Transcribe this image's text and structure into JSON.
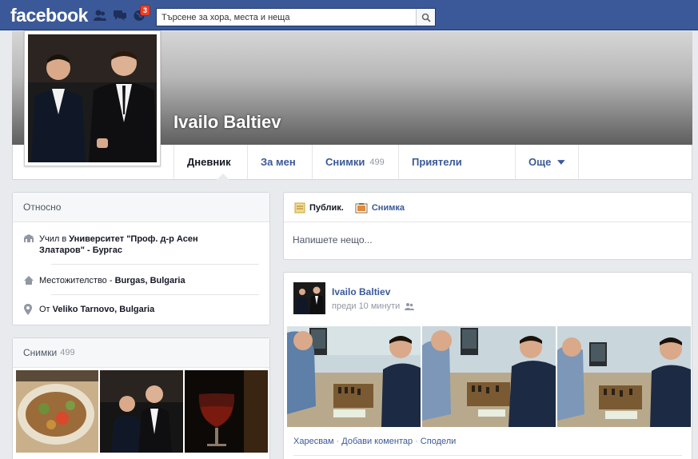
{
  "topbar": {
    "logo": "facebook",
    "notifications_count": "3",
    "search_placeholder": "Търсене за хора, места и неща"
  },
  "profile": {
    "name": "Ivailo Baltiev"
  },
  "nav": {
    "tabs": [
      {
        "label": "Дневник"
      },
      {
        "label": "За мен"
      },
      {
        "label": "Снимки",
        "count": "499"
      },
      {
        "label": "Приятели"
      },
      {
        "label": "Още"
      }
    ]
  },
  "about": {
    "title": "Относно",
    "studied_prefix": "Учил в",
    "studied_place": "Университет \"Проф. д-р Асен Златаров\" - Бургас",
    "lives_prefix": "Местожителство -",
    "lives_place": "Burgas, Bulgaria",
    "from_prefix": "От",
    "from_place": "Veliko Tarnovo, Bulgaria"
  },
  "photos_card": {
    "title": "Снимки",
    "count": "499"
  },
  "composer": {
    "tab_status": "Публик.",
    "tab_photo": "Снимка",
    "placeholder": "Напишете нещо..."
  },
  "post": {
    "author": "Ivailo Baltiev",
    "time": "преди 10 минути",
    "actions": {
      "like": "Харесвам",
      "comment": "Добави коментар",
      "share": "Сподели"
    }
  },
  "colors": {
    "brand": "#3b5998",
    "page_bg": "#e9eaed",
    "badge": "#f03d25"
  }
}
